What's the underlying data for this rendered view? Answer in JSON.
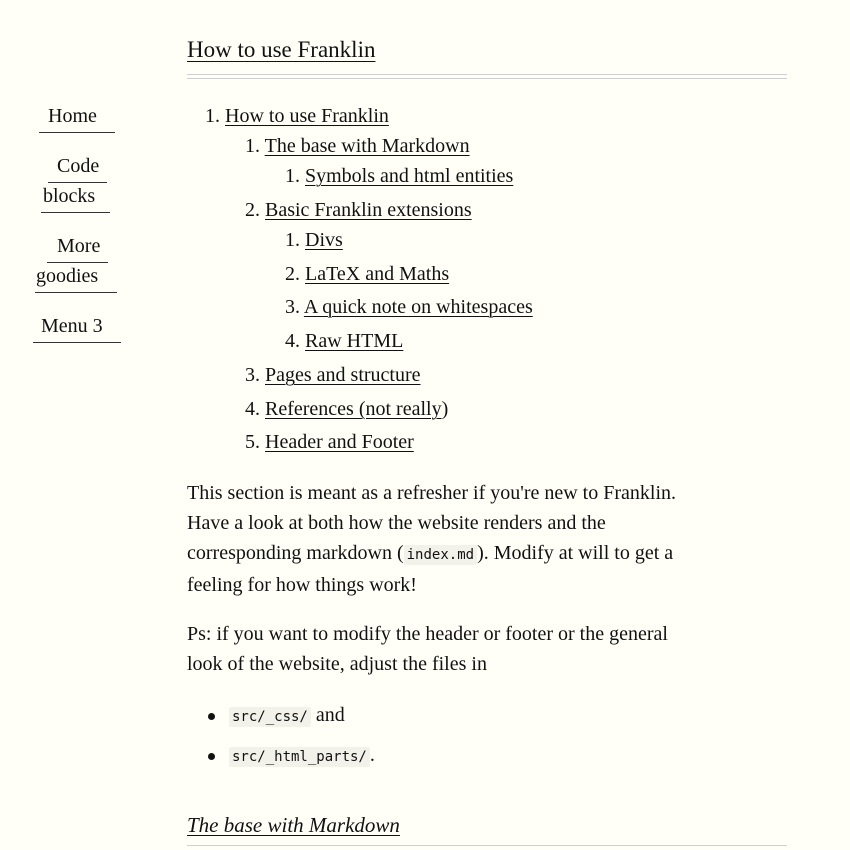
{
  "header": {
    "title": "How to use Franklin"
  },
  "sidebar": {
    "items": [
      {
        "label_lines": [
          "Home"
        ]
      },
      {
        "label_lines": [
          "Code",
          "blocks"
        ]
      },
      {
        "label_lines": [
          "More",
          "goodies"
        ]
      },
      {
        "label_lines": [
          "Menu 3"
        ]
      }
    ]
  },
  "toc": {
    "items": [
      {
        "num": "1.",
        "label": "How to use Franklin",
        "level": 1
      },
      {
        "num": "1.",
        "label": "The base with Markdown",
        "level": 2
      },
      {
        "num": "1.",
        "label": "Symbols and html entities",
        "level": 3
      },
      {
        "num": "2.",
        "label": "Basic Franklin extensions",
        "level": 2
      },
      {
        "num": "1.",
        "label": "Divs",
        "level": 3
      },
      {
        "num": "2.",
        "label": "LaTeX and Maths",
        "level": 3
      },
      {
        "num": "3.",
        "label": "A quick note on whitespaces",
        "level": 3
      },
      {
        "num": "4.",
        "label": "Raw HTML",
        "level": 3
      },
      {
        "num": "3.",
        "label": "Pages and structure",
        "level": 2
      },
      {
        "num": "4.",
        "label": "References (not really",
        "suffix": ")",
        "level": 2
      },
      {
        "num": "5.",
        "label": "Header and Footer",
        "level": 2
      }
    ]
  },
  "intro": {
    "line1": "This section is meant as a refresher if you're new to Franklin.",
    "line2": "Have a look at both how the website renders and the",
    "line3_pre": "corresponding markdown (",
    "line3_code": "index.md",
    "line3_post": "). Modify at will to get a",
    "line4": "feeling for how things work!"
  },
  "ps": {
    "line1": "Ps: if you want to modify the header or footer or the general",
    "line2": "look of the website, adjust the files in"
  },
  "files": [
    {
      "code": "src/_css/",
      "after": " and"
    },
    {
      "code": "src/_html_parts/",
      "after": "."
    }
  ],
  "next_section": {
    "heading": "The base with Markdown"
  }
}
